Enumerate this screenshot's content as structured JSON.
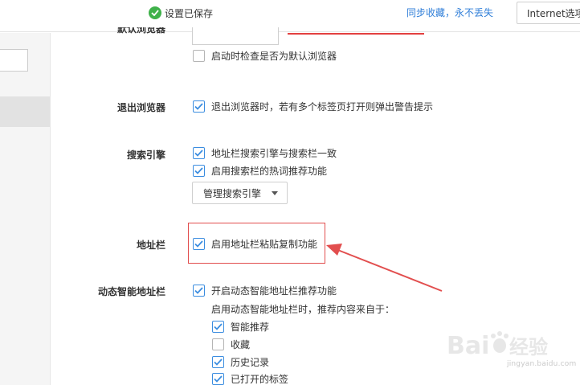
{
  "topbar": {
    "saved_text": "设置已保存",
    "sync_link": "同步收藏，永不丢失",
    "ie_button": "Internet选项"
  },
  "sections": {
    "default_browser": {
      "label": "默认浏览器",
      "check_on_start": "启动时检查是否为默认浏览器",
      "check_on_start_checked": false
    },
    "exit": {
      "label": "退出浏览器",
      "warn_multiple_tabs": "退出浏览器时，若有多个标签页打开则弹出警告提示",
      "warn_multiple_tabs_checked": true
    },
    "search": {
      "label": "搜索引擎",
      "same_engine": "地址栏搜索引擎与搜索栏一致",
      "same_engine_checked": true,
      "hot_words": "启用搜索栏的热词推荐功能",
      "hot_words_checked": true,
      "manage_button": "管理搜索引擎"
    },
    "address_bar": {
      "label": "地址栏",
      "paste_copy": "启用地址栏粘贴复制功能",
      "paste_copy_checked": true
    },
    "smart_address_bar": {
      "label": "动态智能地址栏",
      "enable": "开启动态智能地址栏推荐功能",
      "enable_checked": true,
      "source_intro": "启用动态智能地址栏时，推荐内容来自于：",
      "sources": [
        {
          "label": "智能推荐",
          "checked": true
        },
        {
          "label": "收藏",
          "checked": false
        },
        {
          "label": "历史记录",
          "checked": true
        },
        {
          "label": "已打开的标签",
          "checked": true
        }
      ]
    }
  },
  "watermark": {
    "brand": "Bai",
    "brand_cn": "经验",
    "site": "jingyan.baidu.com"
  },
  "colors": {
    "accent": "#3b8de0",
    "success": "#3fb14a",
    "highlight": "#e24e4e",
    "link": "#2f7ed8"
  }
}
